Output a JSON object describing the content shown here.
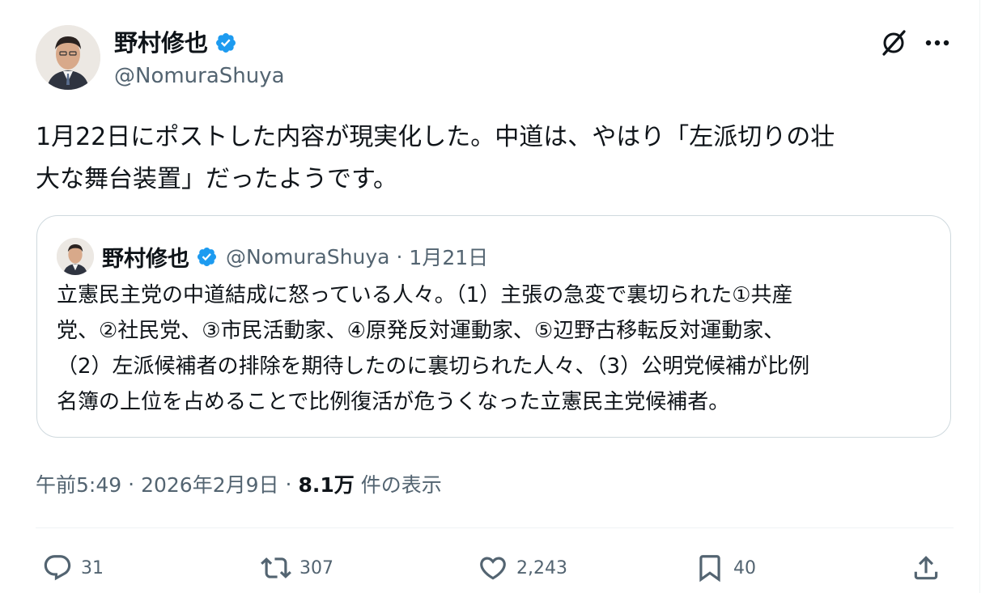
{
  "author": {
    "display_name": "野村修也",
    "handle": "@NomuraShuya"
  },
  "post": {
    "text_line1": "1月22日にポストした内容が現実化した。中道は、やはり「左派切りの壮",
    "text_line2": "大な舞台装置」だったようです。"
  },
  "quote": {
    "display_name": "野村修也",
    "handle": "@NomuraShuya",
    "separator": "·",
    "date": "1月21日",
    "line1": "立憲民主党の中道結成に怒っている人々。（1）主張の急変で裏切られた①共産",
    "line2": "党、②社民党、③市民活動家、④原発反対運動家、⑤辺野古移転反対運動家、",
    "line3": "（2）左派候補者の排除を期待したのに裏切られた人々、（3）公明党候補が比例",
    "line4": "名簿の上位を占めることで比例復活が危うくなった立憲民主党候補者。"
  },
  "meta": {
    "time": "午前5:49",
    "sep1": "·",
    "date": "2026年2月9日",
    "sep2": "·",
    "views_count": "8.1万",
    "views_label": "件の表示"
  },
  "actions": {
    "replies": "31",
    "reposts": "307",
    "likes": "2,243",
    "bookmarks": "40"
  },
  "icons": {
    "verified": "verified-badge-icon",
    "grok": "grok-icon",
    "more": "more-icon",
    "reply": "reply-icon",
    "repost": "repost-icon",
    "like": "like-icon",
    "bookmark": "bookmark-icon",
    "share": "share-icon"
  },
  "colors": {
    "text": "#0f1419",
    "secondary": "#536471",
    "verified": "#1d9bf0",
    "border": "#cfd9de"
  }
}
